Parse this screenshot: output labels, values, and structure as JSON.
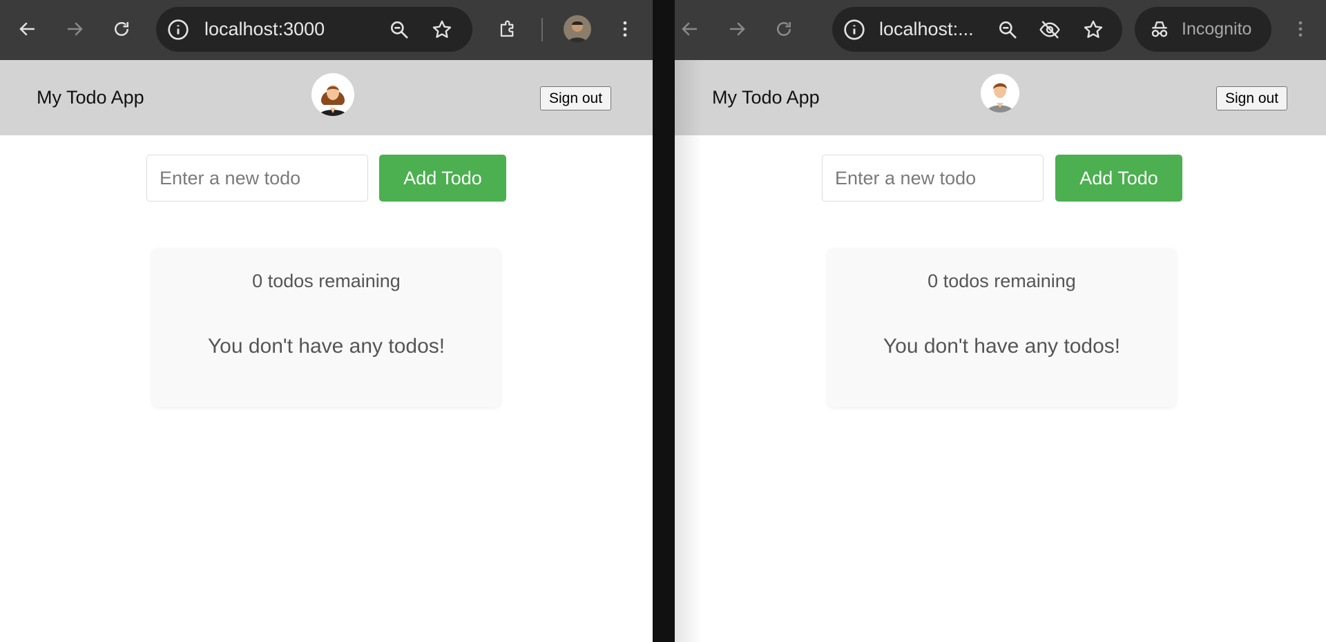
{
  "colors": {
    "toolbar_bg": "#3b3b3b",
    "omnibox_bg": "#242424",
    "header_bg": "#d3d3d3",
    "accent_green": "#4caf50",
    "card_bg": "#f9f9f9"
  },
  "left_window": {
    "address": "localhost:3000",
    "toolbar_icons": [
      "back-arrow-icon",
      "forward-arrow-icon",
      "reload-icon",
      "site-info-icon",
      "zoom-icon",
      "bookmark-star-icon",
      "extensions-puzzle-icon",
      "profile-avatar-icon",
      "more-menu-icon"
    ],
    "app": {
      "title": "My Todo App",
      "avatar": "female-user-avatar-icon",
      "sign_out": "Sign out",
      "input_placeholder": "Enter a new todo",
      "add_button": "Add Todo",
      "remaining": "0 todos remaining",
      "empty_message": "You don't have any todos!"
    }
  },
  "right_window": {
    "address": "localhost:...",
    "incognito_label": "Incognito",
    "toolbar_icons": [
      "back-arrow-icon",
      "forward-arrow-icon",
      "reload-icon",
      "site-info-icon",
      "zoom-icon",
      "eye-slash-icon",
      "bookmark-star-icon",
      "incognito-icon",
      "more-menu-icon"
    ],
    "app": {
      "title": "My Todo App",
      "avatar": "male-user-avatar-icon",
      "sign_out": "Sign out",
      "input_placeholder": "Enter a new todo",
      "add_button": "Add Todo",
      "remaining": "0 todos remaining",
      "empty_message": "You don't have any todos!"
    }
  }
}
